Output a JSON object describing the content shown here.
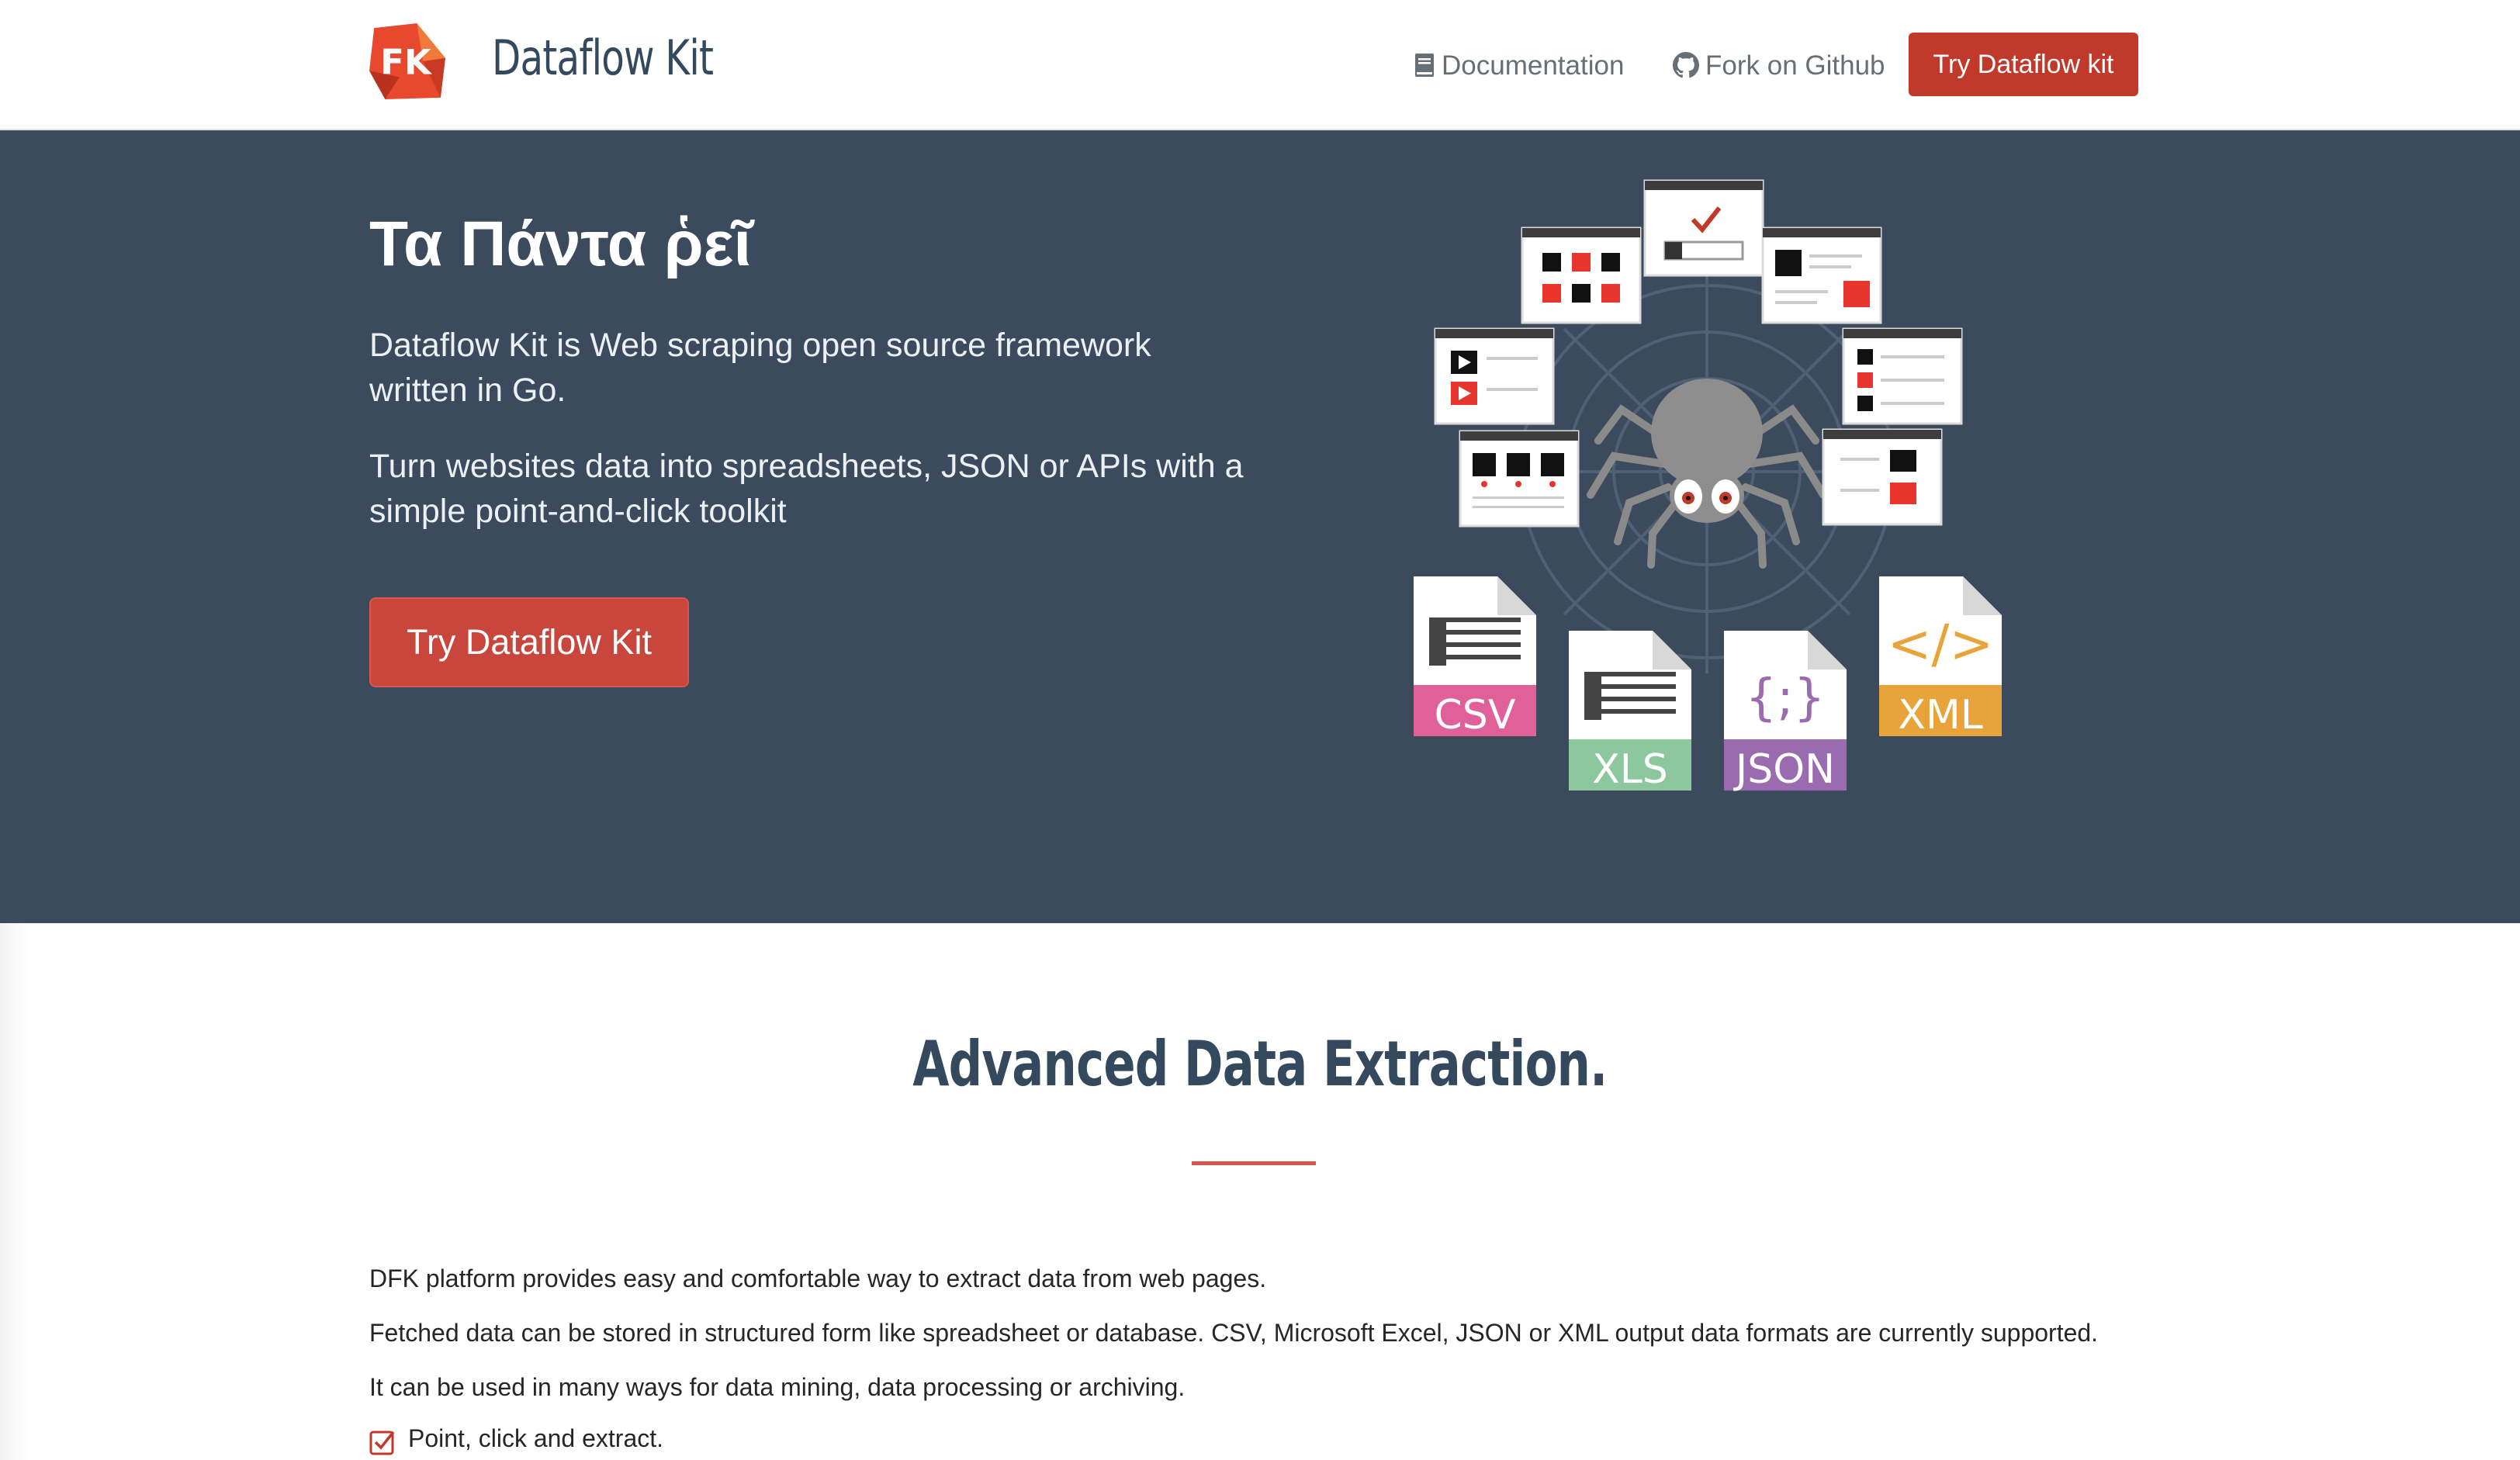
{
  "navbar": {
    "brand": "Dataflow Kit",
    "logo_text": "FK",
    "links": [
      {
        "label": "Documentation",
        "icon": "book-icon"
      },
      {
        "label": "Fork on Github",
        "icon": "github-icon"
      }
    ],
    "cta_label": "Try Dataflow kit"
  },
  "hero": {
    "title": "Τα Πάντα ῥεῖ",
    "paragraph1": "Dataflow Kit is Web scraping open source framework written in Go.",
    "paragraph2": "Turn websites data into spreadsheets, JSON or APIs with a simple point-and-click toolkit",
    "button_label": "Try Dataflow Kit",
    "illustration": {
      "formats": [
        {
          "label": "CSV",
          "color": "#e0609a",
          "glyph": ""
        },
        {
          "label": "XLS",
          "color": "#8cc79e",
          "glyph": ""
        },
        {
          "label": "JSON",
          "color": "#9b6bb0",
          "glyph": "{;}"
        },
        {
          "label": "XML",
          "color": "#e8a33a",
          "glyph": "</>"
        }
      ]
    }
  },
  "section": {
    "title": "Advanced Data Extraction.",
    "paragraphs": [
      "DFK platform provides easy and comfortable way to extract data from web pages.",
      "Fetched data can be stored in structured form like spreadsheet or database. CSV, Microsoft Excel, JSON or XML output data formats are currently supported.",
      "It can be used in many ways for data mining, data processing or archiving."
    ],
    "features": [
      "Point, click and extract."
    ]
  },
  "colors": {
    "hero_bg": "#3b4a5c",
    "accent_red": "#c0392b",
    "heading": "#34495e"
  }
}
